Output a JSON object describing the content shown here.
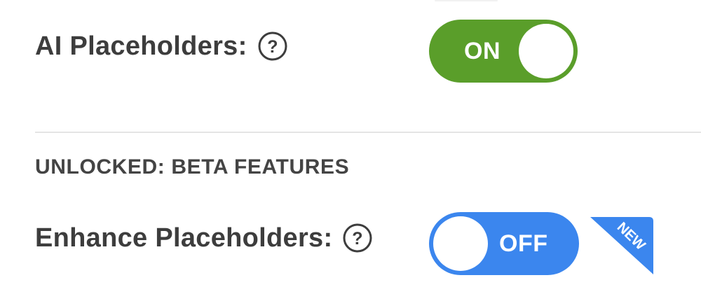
{
  "settings": {
    "ai_placeholders": {
      "label": "AI Placeholders:",
      "help_icon": "question-circle-icon",
      "toggle_text": "ON",
      "state": "on",
      "color": "#5a9e2a"
    },
    "section_heading": "UNLOCKED: BETA FEATURES",
    "enhance_placeholders": {
      "label": "Enhance Placeholders:",
      "help_icon": "question-circle-icon",
      "toggle_text": "OFF",
      "state": "off",
      "color": "#3b86ee",
      "badge": "NEW"
    }
  }
}
